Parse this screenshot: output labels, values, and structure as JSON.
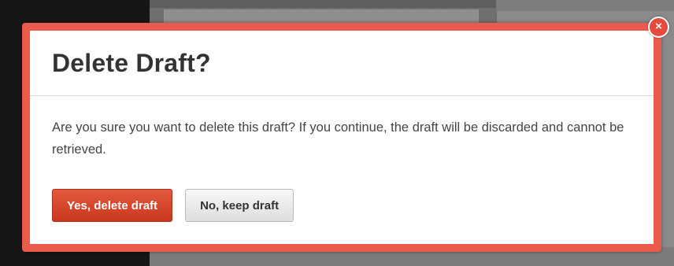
{
  "dialog": {
    "title": "Delete Draft?",
    "message": "Are you sure you want to delete this draft? If you continue, the draft will be discarded and cannot be retrieved.",
    "confirm_label": "Yes, delete draft",
    "cancel_label": "No, keep draft",
    "close_glyph": "×"
  },
  "icons": {
    "close": "close-icon"
  },
  "colors": {
    "frame": "#ea5a4d",
    "confirm_button": "#d6442b",
    "close_button": "#e44a3e"
  }
}
